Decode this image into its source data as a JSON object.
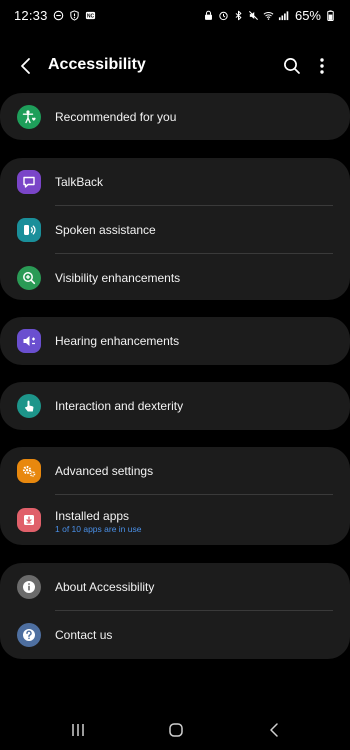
{
  "status_bar": {
    "time": "12:33",
    "battery": "65%"
  },
  "header": {
    "title": "Accessibility"
  },
  "groups": [
    {
      "items": [
        {
          "label": "Recommended for you",
          "icon": "accessibility-person-icon",
          "color": "#1e9e5a"
        }
      ]
    },
    {
      "items": [
        {
          "label": "TalkBack",
          "icon": "talkback-icon",
          "color": "#7a45c8"
        },
        {
          "label": "Spoken assistance",
          "icon": "spoken-assistance-icon",
          "color": "#1a8f9a"
        },
        {
          "label": "Visibility enhancements",
          "icon": "visibility-zoom-icon",
          "color": "#2a9a55"
        }
      ]
    },
    {
      "items": [
        {
          "label": "Hearing enhancements",
          "icon": "hearing-icon",
          "color": "#6a4fcf"
        }
      ]
    },
    {
      "items": [
        {
          "label": "Interaction and dexterity",
          "icon": "touch-hand-icon",
          "color": "#1d958a"
        }
      ]
    },
    {
      "items": [
        {
          "label": "Advanced settings",
          "icon": "advanced-gears-icon",
          "color": "#e8880e"
        },
        {
          "label": "Installed apps",
          "sublabel": "1 of 10 apps are in use",
          "icon": "installed-apps-icon",
          "color": "#e0606a"
        }
      ]
    },
    {
      "items": [
        {
          "label": "About Accessibility",
          "icon": "info-icon",
          "color": "#6b6b6b"
        },
        {
          "label": "Contact us",
          "icon": "help-question-icon",
          "color": "#4e6fa0"
        }
      ]
    }
  ]
}
